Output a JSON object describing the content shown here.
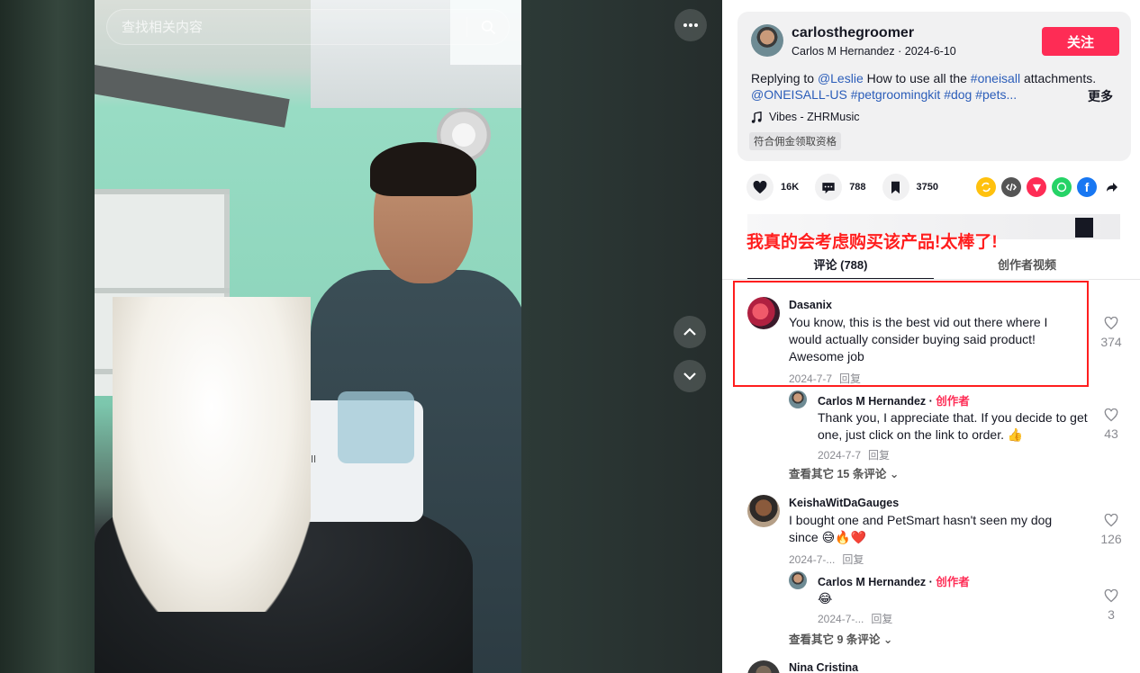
{
  "search": {
    "placeholder": "查找相关内容"
  },
  "video": {
    "device_label": "oneisall"
  },
  "post": {
    "author_handle": "carlosthegroomer",
    "author_sub": "Carlos M Hernandez · 2024-6-10",
    "follow_label": "关注",
    "desc_prefix": "Replying to ",
    "mention": "@Leslie",
    "desc_mid": " How to use all the ",
    "tag1": "#oneisall",
    "desc_after": " attachments.",
    "line2": "@ONEISALL-US #petgroomingkit #dog #pets...",
    "more_label": "更多",
    "music_icon": "note-icon",
    "music": "Vibes - ZHRMusic",
    "badge": "符合佣金领取资格"
  },
  "actions": {
    "likes": "16K",
    "comments": "788",
    "saves": "3750"
  },
  "share_icons": [
    "repost-icon",
    "embed-icon",
    "send-icon",
    "whatsapp-icon",
    "facebook-icon",
    "share-arrow-icon"
  ],
  "overlay_text": "我真的会考虑购买该产品!太棒了!",
  "tabs": {
    "comments": "评论 (788)",
    "creator_videos": "创作者视频"
  },
  "comments": [
    {
      "name": "Dasanix",
      "text": "You know, this is the best vid out there where I would actually consider buying said product! Awesome job",
      "date": "2024-7-7",
      "reply": "回复",
      "likes": "374",
      "replies": [
        {
          "name": "Carlos M Hernandez · ",
          "creator": "创作者",
          "text": "Thank you, I appreciate that. If you decide to get one, just click on the link to order. 👍",
          "date": "2024-7-7",
          "reply": "回复",
          "likes": "43"
        }
      ],
      "view_more": "查看其它 15 条评论 ⌄"
    },
    {
      "name": "KeishaWitDaGauges",
      "text": "I bought one and PetSmart hasn't seen my dog since 😅🔥❤️",
      "date": "2024-7-...",
      "reply": "回复",
      "likes": "126",
      "replies": [
        {
          "name": "Carlos M Hernandez · ",
          "creator": "创作者",
          "text": "😂",
          "date": "2024-7-...",
          "reply": "回复",
          "likes": "3"
        }
      ],
      "view_more": "查看其它 9 条评论 ⌄"
    },
    {
      "name": "Nina Cristina"
    }
  ],
  "colors": {
    "accent": "#fe2c55",
    "link": "#2b5db9",
    "highlight": "#ff1e1e"
  }
}
